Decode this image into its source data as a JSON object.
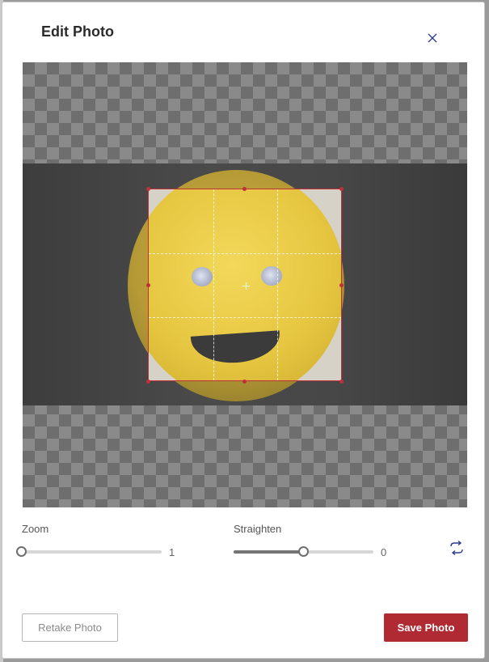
{
  "dialog": {
    "title": "Edit Photo",
    "close_icon": "close-icon"
  },
  "editor": {
    "overlay_color": "#c0303b"
  },
  "zoom": {
    "label": "Zoom",
    "value": "1",
    "level": 0
  },
  "straighten": {
    "label": "Straighten",
    "value": "0",
    "level": 0.5
  },
  "rotate": {
    "icon": "rotate-icon"
  },
  "buttons": {
    "retake_label": "Retake Photo",
    "save_label": "Save Photo",
    "save_color": "#b02a33"
  }
}
